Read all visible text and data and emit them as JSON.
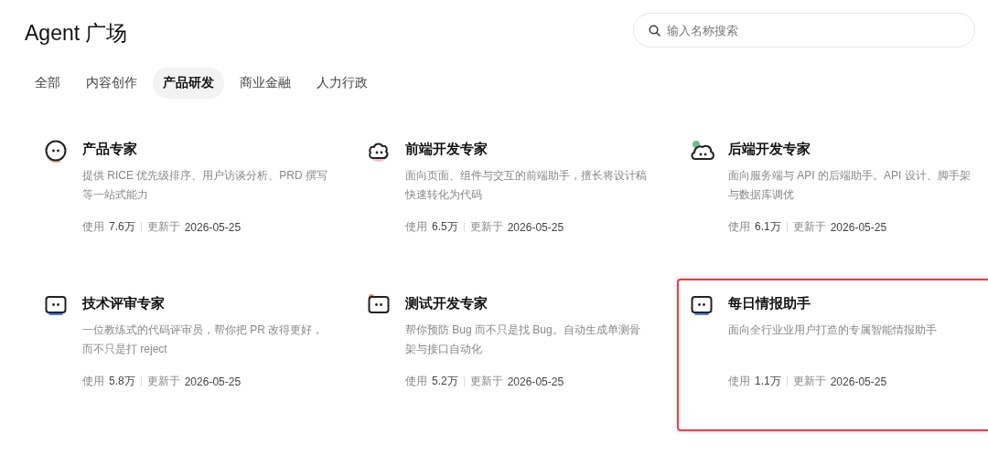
{
  "header": {
    "title": "Agent 广场",
    "search": {
      "placeholder": "输入名称搜索"
    }
  },
  "tabs": [
    {
      "label": "全部",
      "selected": false
    },
    {
      "label": "内容创作",
      "selected": false
    },
    {
      "label": "产品研发",
      "selected": true
    },
    {
      "label": "商业金融",
      "selected": false
    },
    {
      "label": "人力行政",
      "selected": false
    }
  ],
  "agents": [
    {
      "name": "产品专家",
      "description": "提供 RICE 优先级排序、用户访谈分析、PRD 撰写等一站式能力",
      "usage_label": "使用",
      "usage": "7.6万",
      "updated_label": "更新于",
      "updated": "2026-05-25",
      "highlighted": false
    },
    {
      "name": "前端开发专家",
      "description": "面向页面、组件与交互的前端助手，擅长将设计稿快速转化为代码",
      "usage_label": "使用",
      "usage": "6.5万",
      "updated_label": "更新于",
      "updated": "2026-05-25",
      "highlighted": false
    },
    {
      "name": "后端开发专家",
      "description": "面向服务端与 API 的后端助手。API 设计、脚手架与数据库调优",
      "usage_label": "使用",
      "usage": "6.1万",
      "updated_label": "更新于",
      "updated": "2026-05-25",
      "highlighted": false
    },
    {
      "name": "技术评审专家",
      "description": "一位教练式的代码评审员，帮你把 PR 改得更好，而不只是打 reject",
      "usage_label": "使用",
      "usage": "5.8万",
      "updated_label": "更新于",
      "updated": "2026-05-25",
      "highlighted": false
    },
    {
      "name": "测试开发专家",
      "description": "帮你预防 Bug 而不只是找 Bug。自动生成单测骨架与接口自动化",
      "usage_label": "使用",
      "usage": "5.2万",
      "updated_label": "更新于",
      "updated": "2026-05-25",
      "highlighted": false
    },
    {
      "name": "每日情报助手",
      "description": "面向全行业业用户打造的专属智能情报助手",
      "usage_label": "使用",
      "usage": "1.1万",
      "updated_label": "更新于",
      "updated": "2026-05-25",
      "highlighted": true
    }
  ]
}
